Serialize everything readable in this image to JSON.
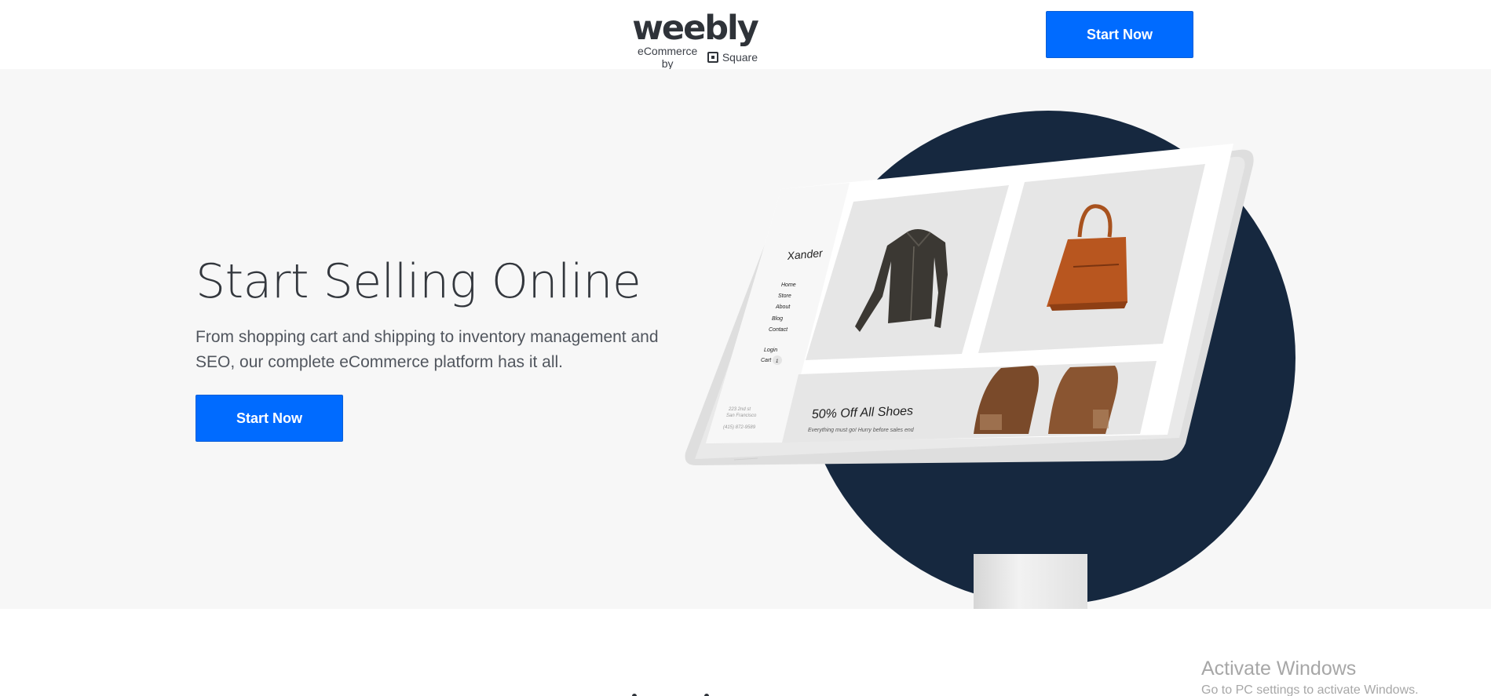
{
  "header": {
    "logo_word": "weebly",
    "logo_sub_prefix": "eCommerce by",
    "logo_sub_brand": "Square",
    "cta_label": "Start Now"
  },
  "hero": {
    "title": "Start Selling Online",
    "subtitle": "From shopping cart and shipping to inventory management and SEO, our complete eCommerce platform has it all.",
    "cta_label": "Start Now"
  },
  "mockup": {
    "site_name": "Xander",
    "nav_items": [
      "Home",
      "Store",
      "About",
      "Blog",
      "Contact"
    ],
    "login_label": "Login",
    "cart_label": "Cart",
    "cart_count": "1",
    "address_line1": "223 2nd st",
    "address_line2": "San Francisco",
    "phone": "(415) 872-9589",
    "promo_title": "50% Off All Shoes",
    "promo_text": "Everything must go! Hurry before sales end"
  },
  "watermark": {
    "title": "Activate Windows",
    "subtitle": "Go to PC settings to activate Windows."
  },
  "colors": {
    "accent": "#006bff",
    "hero_bg": "#f7f7f7",
    "circle": "#16283f"
  }
}
